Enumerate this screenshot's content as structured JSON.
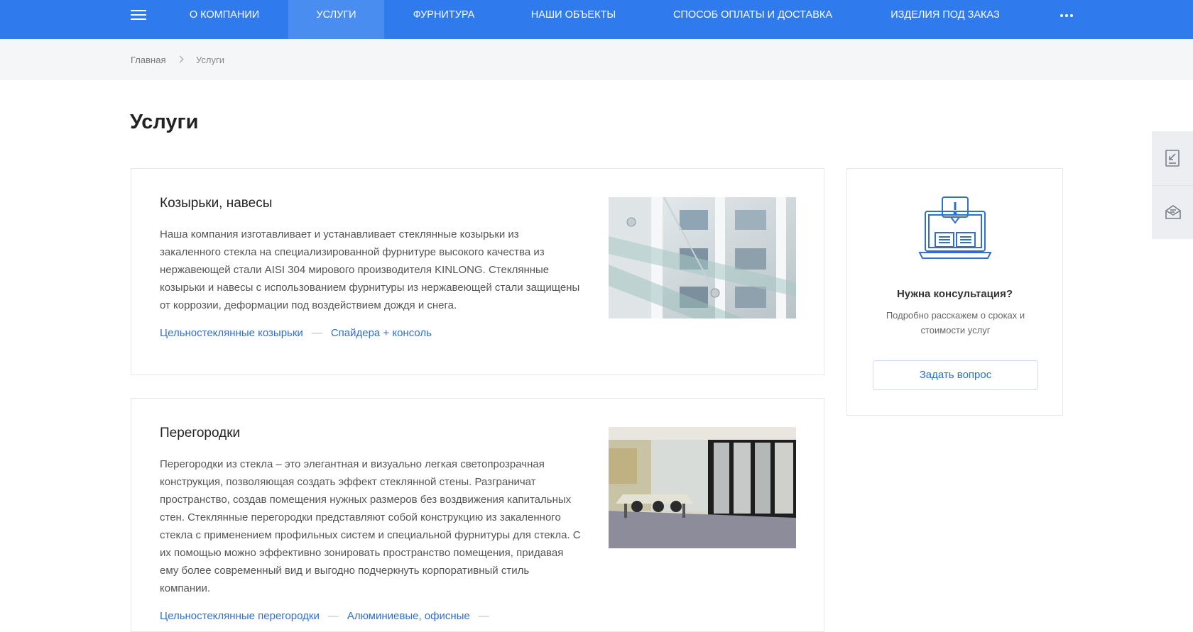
{
  "nav": {
    "items": [
      {
        "label": "О компании"
      },
      {
        "label": "Услуги"
      },
      {
        "label": "Фурнитура"
      },
      {
        "label": "Наши объекты"
      },
      {
        "label": "Способ оплаты и доставка"
      },
      {
        "label": "Изделия под заказ"
      }
    ],
    "active_item": "Услуги",
    "more_icon": "ellipsis-icon",
    "menu_icon": "hamburger-menu-icon"
  },
  "breadcrumb": {
    "home": "Главная",
    "current": "Услуги"
  },
  "page_title": "Услуги",
  "services": [
    {
      "title": "Козырьки, навесы",
      "text": "Наша компания изготавливает и устанавливает стеклянные козырьки из закаленного стекла на специализированной фурнитуре высокого качества из нержавеющей стали AISI 304 мирового производителя KINLONG. Стеклянные козырьки и навесы с использованием фурнитуры из нержавеющей стали защищены от коррозии, деформации под воздействием дождя и снега.",
      "links": [
        "Цельностеклянные козырьки",
        "Спайдера + консоль"
      ]
    },
    {
      "title": "Перегородки",
      "text": "Перегородки из стекла – это элегантная и визуально легкая светопрозрачная конструкция, позволяющая создать эффект стеклянной стены. Разграничат пространство, создав помещения нужных размеров без воздвижения капитальных стен. Стеклянные перегородки представляют собой конструкцию из закаленного стекла с применением профильных систем и специальной фурнитуры для стекла. С их помощью можно эффективно зонировать пространство помещения, придавая ему более современный вид и выгодно подчеркнуть корпоративный стиль компании.",
      "links": [
        "Цельностеклянные перегородки",
        "Алюминиевые, офисные"
      ]
    }
  ],
  "consult": {
    "title": "Нужна консультация?",
    "text": "Подробно расскажем о сроках и стоимости услуг",
    "button": "Задать вопрос",
    "icon": "laptop-consultation-icon"
  },
  "side_tabs": [
    "document-download-icon",
    "mail-icon"
  ],
  "colors": {
    "brand": "#2F7BEE",
    "link": "#2F6FD0",
    "active_nav": "#4A8DF0"
  }
}
